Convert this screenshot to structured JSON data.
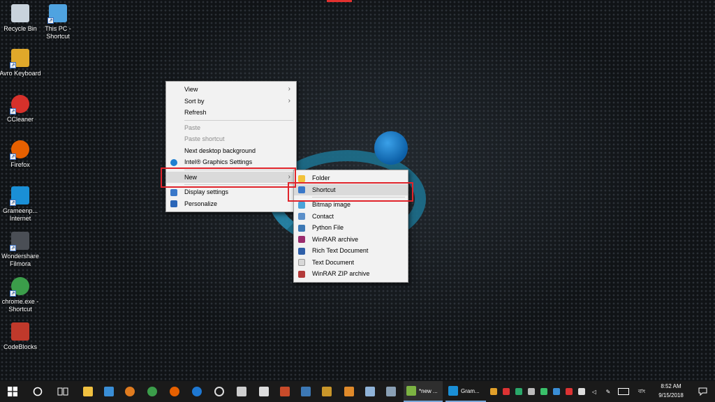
{
  "desktop": {
    "icons": [
      {
        "label": "Recycle Bin",
        "icon": "recycle-bin-icon",
        "color": "#c9d3dc"
      },
      {
        "label": "This PC - Shortcut",
        "icon": "computer-icon",
        "color": "#4fa3e0"
      },
      {
        "label": "Avro Keyboard",
        "icon": "keyboard-icon",
        "color": "#e0a82a"
      },
      {
        "label": "CCleaner",
        "icon": "ccleaner-icon",
        "color": "#d7312b"
      },
      {
        "label": "Firefox",
        "icon": "firefox-icon",
        "color": "#e66000"
      },
      {
        "label": "Grameenp... Internet",
        "icon": "grameenphone-icon",
        "color": "#1a8fd6"
      },
      {
        "label": "Wondershare Filmora",
        "icon": "filmora-icon",
        "color": "#4a4e55"
      },
      {
        "label": "chrome.exe - Shortcut",
        "icon": "chrome-icon",
        "color": "#3b9d4a"
      },
      {
        "label": "CodeBlocks",
        "icon": "codeblocks-icon",
        "color": "#c0392b"
      }
    ]
  },
  "context_menu": {
    "items": [
      {
        "label": "View",
        "has_submenu": true,
        "disabled": false
      },
      {
        "label": "Sort by",
        "has_submenu": true,
        "disabled": false
      },
      {
        "label": "Refresh",
        "has_submenu": false,
        "disabled": false
      },
      {
        "label": "Paste",
        "has_submenu": false,
        "disabled": true
      },
      {
        "label": "Paste shortcut",
        "has_submenu": false,
        "disabled": true
      },
      {
        "label": "Next desktop background",
        "has_submenu": false,
        "disabled": false
      },
      {
        "label": "Intel® Graphics Settings",
        "has_submenu": false,
        "disabled": false,
        "icon": "intel-graphics-icon"
      },
      {
        "label": "New",
        "has_submenu": true,
        "disabled": false,
        "highlighted": true
      },
      {
        "label": "Display settings",
        "has_submenu": false,
        "disabled": false,
        "icon": "display-icon"
      },
      {
        "label": "Personalize",
        "has_submenu": false,
        "disabled": false,
        "icon": "personalize-icon"
      }
    ],
    "chevron": "›"
  },
  "new_submenu": {
    "items": [
      {
        "label": "Folder",
        "icon": "folder-icon",
        "color": "#f2c23a"
      },
      {
        "label": "Shortcut",
        "icon": "shortcut-icon",
        "color": "#3a78c9",
        "highlighted": true
      },
      {
        "label": "Bitmap image",
        "icon": "bitmap-icon",
        "color": "#4aa3d8"
      },
      {
        "label": "Contact",
        "icon": "contact-icon",
        "color": "#5b8fc9"
      },
      {
        "label": "Python File",
        "icon": "python-file-icon",
        "color": "#3c78b5"
      },
      {
        "label": "WinRAR archive",
        "icon": "winrar-icon",
        "color": "#9b2c6e"
      },
      {
        "label": "Rich Text Document",
        "icon": "rich-text-icon",
        "color": "#2f5fa8"
      },
      {
        "label": "Text Document",
        "icon": "text-document-icon",
        "color": "#d8d8d8"
      },
      {
        "label": "WinRAR ZIP archive",
        "icon": "winrar-zip-icon",
        "color": "#b33a3a"
      }
    ]
  },
  "taskbar": {
    "start_icon": "windows-start-icon",
    "search_icon": "cortana-circle-icon",
    "task_view_icon": "task-view-icon",
    "apps": [
      {
        "icon": "file-explorer-icon",
        "color": "#f0c040"
      },
      {
        "icon": "network-icon",
        "color": "#3a8ed6"
      },
      {
        "icon": "search-app-icon",
        "color": "#e07b1f"
      },
      {
        "icon": "chrome-icon",
        "color": "#3b9d4a"
      },
      {
        "icon": "firefox-icon",
        "color": "#e66000"
      },
      {
        "icon": "edge-icon",
        "color": "#1e78d2"
      },
      {
        "icon": "target-icon",
        "color": "#dddddd"
      },
      {
        "icon": "photos-icon",
        "color": "#cfcfcf"
      },
      {
        "icon": "film-icon",
        "color": "#dddddd"
      },
      {
        "icon": "office-icon",
        "color": "#c94b2a"
      },
      {
        "icon": "python-icon",
        "color": "#3c78b5"
      },
      {
        "icon": "avro-icon",
        "color": "#c9962a"
      },
      {
        "icon": "sublime-icon",
        "color": "#e08a2a"
      },
      {
        "icon": "box-icon",
        "color": "#8fb3d8"
      },
      {
        "icon": "monitor-icon",
        "color": "#8aa0b5"
      }
    ],
    "running": [
      {
        "icon": "notepad-plus-icon",
        "label": "*new ...",
        "color": "#7cb342"
      },
      {
        "icon": "grameenphone-icon",
        "label": "Gram...",
        "color": "#1a8fd6"
      }
    ],
    "language": "বাং",
    "time": "8:52 AM",
    "date": "9/15/2018",
    "notification_icon": "notification-icon"
  }
}
